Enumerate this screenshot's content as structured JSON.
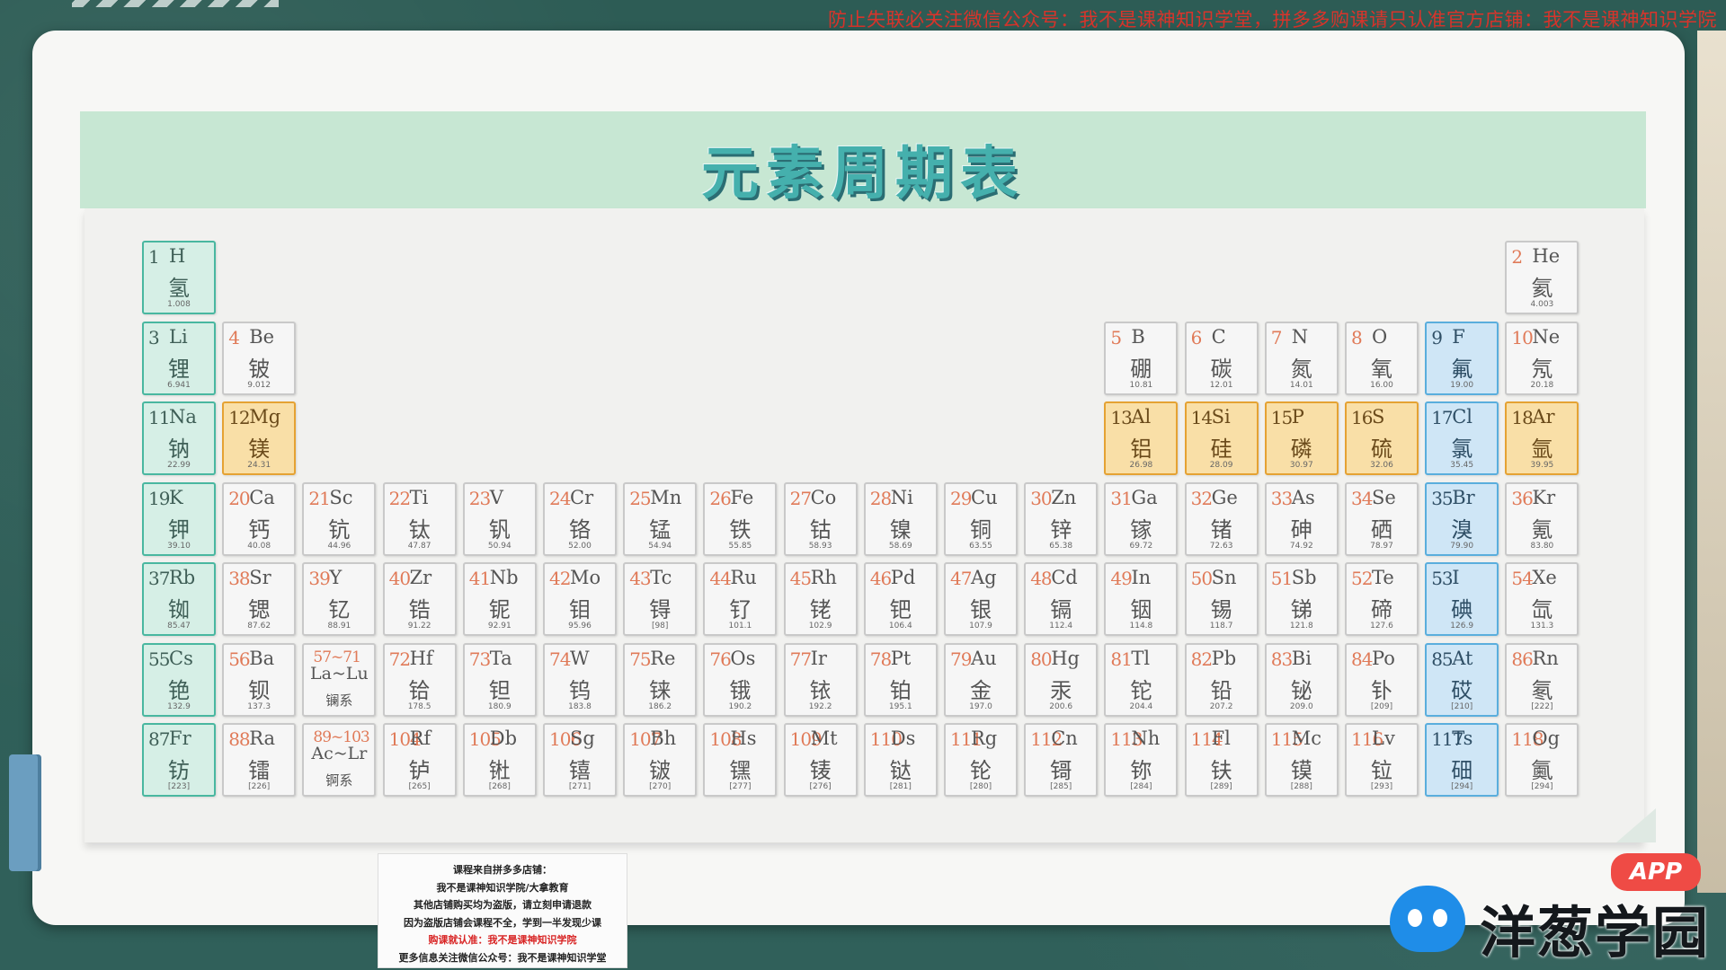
{
  "top_notice": "防止失联必关注微信公众号：我不是课神知识学堂，拼多多购课请只认准官方店铺：我不是课神知识学院",
  "title": "元素周期表",
  "colors": {
    "alkali": "#d6efe6",
    "metal": "#f9dfa7",
    "halogen": "#cfe6f6",
    "default": "#f6f6f6",
    "number": "#e07a58"
  },
  "elements": [
    {
      "n": "1",
      "s": "H",
      "c": "氢",
      "m": "1.008",
      "row": 1,
      "col": 1,
      "t": "alkali"
    },
    {
      "n": "2",
      "s": "He",
      "c": "氦",
      "m": "4.003",
      "row": 1,
      "col": 18,
      "t": ""
    },
    {
      "n": "3",
      "s": "Li",
      "c": "锂",
      "m": "6.941",
      "row": 2,
      "col": 1,
      "t": "alkali"
    },
    {
      "n": "4",
      "s": "Be",
      "c": "铍",
      "m": "9.012",
      "row": 2,
      "col": 2,
      "t": ""
    },
    {
      "n": "5",
      "s": "B",
      "c": "硼",
      "m": "10.81",
      "row": 2,
      "col": 13,
      "t": ""
    },
    {
      "n": "6",
      "s": "C",
      "c": "碳",
      "m": "12.01",
      "row": 2,
      "col": 14,
      "t": ""
    },
    {
      "n": "7",
      "s": "N",
      "c": "氮",
      "m": "14.01",
      "row": 2,
      "col": 15,
      "t": ""
    },
    {
      "n": "8",
      "s": "O",
      "c": "氧",
      "m": "16.00",
      "row": 2,
      "col": 16,
      "t": ""
    },
    {
      "n": "9",
      "s": "F",
      "c": "氟",
      "m": "19.00",
      "row": 2,
      "col": 17,
      "t": "halogen"
    },
    {
      "n": "10",
      "s": "Ne",
      "c": "氖",
      "m": "20.18",
      "row": 2,
      "col": 18,
      "t": ""
    },
    {
      "n": "11",
      "s": "Na",
      "c": "钠",
      "m": "22.99",
      "row": 3,
      "col": 1,
      "t": "alkali"
    },
    {
      "n": "12",
      "s": "Mg",
      "c": "镁",
      "m": "24.31",
      "row": 3,
      "col": 2,
      "t": "metal"
    },
    {
      "n": "13",
      "s": "Al",
      "c": "铝",
      "m": "26.98",
      "row": 3,
      "col": 13,
      "t": "metal"
    },
    {
      "n": "14",
      "s": "Si",
      "c": "硅",
      "m": "28.09",
      "row": 3,
      "col": 14,
      "t": "metal"
    },
    {
      "n": "15",
      "s": "P",
      "c": "磷",
      "m": "30.97",
      "row": 3,
      "col": 15,
      "t": "metal"
    },
    {
      "n": "16",
      "s": "S",
      "c": "硫",
      "m": "32.06",
      "row": 3,
      "col": 16,
      "t": "metal"
    },
    {
      "n": "17",
      "s": "Cl",
      "c": "氯",
      "m": "35.45",
      "row": 3,
      "col": 17,
      "t": "halogen"
    },
    {
      "n": "18",
      "s": "Ar",
      "c": "氩",
      "m": "39.95",
      "row": 3,
      "col": 18,
      "t": "metal"
    },
    {
      "n": "19",
      "s": "K",
      "c": "钾",
      "m": "39.10",
      "row": 4,
      "col": 1,
      "t": "alkali"
    },
    {
      "n": "20",
      "s": "Ca",
      "c": "钙",
      "m": "40.08",
      "row": 4,
      "col": 2,
      "t": ""
    },
    {
      "n": "21",
      "s": "Sc",
      "c": "钪",
      "m": "44.96",
      "row": 4,
      "col": 3,
      "t": ""
    },
    {
      "n": "22",
      "s": "Ti",
      "c": "钛",
      "m": "47.87",
      "row": 4,
      "col": 4,
      "t": ""
    },
    {
      "n": "23",
      "s": "V",
      "c": "钒",
      "m": "50.94",
      "row": 4,
      "col": 5,
      "t": ""
    },
    {
      "n": "24",
      "s": "Cr",
      "c": "铬",
      "m": "52.00",
      "row": 4,
      "col": 6,
      "t": ""
    },
    {
      "n": "25",
      "s": "Mn",
      "c": "锰",
      "m": "54.94",
      "row": 4,
      "col": 7,
      "t": ""
    },
    {
      "n": "26",
      "s": "Fe",
      "c": "铁",
      "m": "55.85",
      "row": 4,
      "col": 8,
      "t": ""
    },
    {
      "n": "27",
      "s": "Co",
      "c": "钴",
      "m": "58.93",
      "row": 4,
      "col": 9,
      "t": ""
    },
    {
      "n": "28",
      "s": "Ni",
      "c": "镍",
      "m": "58.69",
      "row": 4,
      "col": 10,
      "t": ""
    },
    {
      "n": "29",
      "s": "Cu",
      "c": "铜",
      "m": "63.55",
      "row": 4,
      "col": 11,
      "t": ""
    },
    {
      "n": "30",
      "s": "Zn",
      "c": "锌",
      "m": "65.38",
      "row": 4,
      "col": 12,
      "t": ""
    },
    {
      "n": "31",
      "s": "Ga",
      "c": "镓",
      "m": "69.72",
      "row": 4,
      "col": 13,
      "t": ""
    },
    {
      "n": "32",
      "s": "Ge",
      "c": "锗",
      "m": "72.63",
      "row": 4,
      "col": 14,
      "t": ""
    },
    {
      "n": "33",
      "s": "As",
      "c": "砷",
      "m": "74.92",
      "row": 4,
      "col": 15,
      "t": ""
    },
    {
      "n": "34",
      "s": "Se",
      "c": "硒",
      "m": "78.97",
      "row": 4,
      "col": 16,
      "t": ""
    },
    {
      "n": "35",
      "s": "Br",
      "c": "溴",
      "m": "79.90",
      "row": 4,
      "col": 17,
      "t": "halogen"
    },
    {
      "n": "36",
      "s": "Kr",
      "c": "氪",
      "m": "83.80",
      "row": 4,
      "col": 18,
      "t": ""
    },
    {
      "n": "37",
      "s": "Rb",
      "c": "铷",
      "m": "85.47",
      "row": 5,
      "col": 1,
      "t": "alkali"
    },
    {
      "n": "38",
      "s": "Sr",
      "c": "锶",
      "m": "87.62",
      "row": 5,
      "col": 2,
      "t": ""
    },
    {
      "n": "39",
      "s": "Y",
      "c": "钇",
      "m": "88.91",
      "row": 5,
      "col": 3,
      "t": ""
    },
    {
      "n": "40",
      "s": "Zr",
      "c": "锆",
      "m": "91.22",
      "row": 5,
      "col": 4,
      "t": ""
    },
    {
      "n": "41",
      "s": "Nb",
      "c": "铌",
      "m": "92.91",
      "row": 5,
      "col": 5,
      "t": ""
    },
    {
      "n": "42",
      "s": "Mo",
      "c": "钼",
      "m": "95.96",
      "row": 5,
      "col": 6,
      "t": ""
    },
    {
      "n": "43",
      "s": "Tc",
      "c": "锝",
      "m": "[98]",
      "row": 5,
      "col": 7,
      "t": ""
    },
    {
      "n": "44",
      "s": "Ru",
      "c": "钌",
      "m": "101.1",
      "row": 5,
      "col": 8,
      "t": ""
    },
    {
      "n": "45",
      "s": "Rh",
      "c": "铑",
      "m": "102.9",
      "row": 5,
      "col": 9,
      "t": ""
    },
    {
      "n": "46",
      "s": "Pd",
      "c": "钯",
      "m": "106.4",
      "row": 5,
      "col": 10,
      "t": ""
    },
    {
      "n": "47",
      "s": "Ag",
      "c": "银",
      "m": "107.9",
      "row": 5,
      "col": 11,
      "t": ""
    },
    {
      "n": "48",
      "s": "Cd",
      "c": "镉",
      "m": "112.4",
      "row": 5,
      "col": 12,
      "t": ""
    },
    {
      "n": "49",
      "s": "In",
      "c": "铟",
      "m": "114.8",
      "row": 5,
      "col": 13,
      "t": ""
    },
    {
      "n": "50",
      "s": "Sn",
      "c": "锡",
      "m": "118.7",
      "row": 5,
      "col": 14,
      "t": ""
    },
    {
      "n": "51",
      "s": "Sb",
      "c": "锑",
      "m": "121.8",
      "row": 5,
      "col": 15,
      "t": ""
    },
    {
      "n": "52",
      "s": "Te",
      "c": "碲",
      "m": "127.6",
      "row": 5,
      "col": 16,
      "t": ""
    },
    {
      "n": "53",
      "s": "I",
      "c": "碘",
      "m": "126.9",
      "row": 5,
      "col": 17,
      "t": "halogen"
    },
    {
      "n": "54",
      "s": "Xe",
      "c": "氙",
      "m": "131.3",
      "row": 5,
      "col": 18,
      "t": ""
    },
    {
      "n": "55",
      "s": "Cs",
      "c": "铯",
      "m": "132.9",
      "row": 6,
      "col": 1,
      "t": "alkali"
    },
    {
      "n": "56",
      "s": "Ba",
      "c": "钡",
      "m": "137.3",
      "row": 6,
      "col": 2,
      "t": ""
    },
    {
      "n": "57~71",
      "s": "La~Lu",
      "c": "镧系",
      "m": "",
      "row": 6,
      "col": 3,
      "t": "lanth"
    },
    {
      "n": "72",
      "s": "Hf",
      "c": "铪",
      "m": "178.5",
      "row": 6,
      "col": 4,
      "t": ""
    },
    {
      "n": "73",
      "s": "Ta",
      "c": "钽",
      "m": "180.9",
      "row": 6,
      "col": 5,
      "t": ""
    },
    {
      "n": "74",
      "s": "W",
      "c": "钨",
      "m": "183.8",
      "row": 6,
      "col": 6,
      "t": ""
    },
    {
      "n": "75",
      "s": "Re",
      "c": "铼",
      "m": "186.2",
      "row": 6,
      "col": 7,
      "t": ""
    },
    {
      "n": "76",
      "s": "Os",
      "c": "锇",
      "m": "190.2",
      "row": 6,
      "col": 8,
      "t": ""
    },
    {
      "n": "77",
      "s": "Ir",
      "c": "铱",
      "m": "192.2",
      "row": 6,
      "col": 9,
      "t": ""
    },
    {
      "n": "78",
      "s": "Pt",
      "c": "铂",
      "m": "195.1",
      "row": 6,
      "col": 10,
      "t": ""
    },
    {
      "n": "79",
      "s": "Au",
      "c": "金",
      "m": "197.0",
      "row": 6,
      "col": 11,
      "t": ""
    },
    {
      "n": "80",
      "s": "Hg",
      "c": "汞",
      "m": "200.6",
      "row": 6,
      "col": 12,
      "t": ""
    },
    {
      "n": "81",
      "s": "Tl",
      "c": "铊",
      "m": "204.4",
      "row": 6,
      "col": 13,
      "t": ""
    },
    {
      "n": "82",
      "s": "Pb",
      "c": "铅",
      "m": "207.2",
      "row": 6,
      "col": 14,
      "t": ""
    },
    {
      "n": "83",
      "s": "Bi",
      "c": "铋",
      "m": "209.0",
      "row": 6,
      "col": 15,
      "t": ""
    },
    {
      "n": "84",
      "s": "Po",
      "c": "钋",
      "m": "[209]",
      "row": 6,
      "col": 16,
      "t": ""
    },
    {
      "n": "85",
      "s": "At",
      "c": "砹",
      "m": "[210]",
      "row": 6,
      "col": 17,
      "t": "halogen"
    },
    {
      "n": "86",
      "s": "Rn",
      "c": "氡",
      "m": "[222]",
      "row": 6,
      "col": 18,
      "t": ""
    },
    {
      "n": "87",
      "s": "Fr",
      "c": "钫",
      "m": "[223]",
      "row": 7,
      "col": 1,
      "t": "alkali"
    },
    {
      "n": "88",
      "s": "Ra",
      "c": "镭",
      "m": "[226]",
      "row": 7,
      "col": 2,
      "t": ""
    },
    {
      "n": "89~103",
      "s": "Ac~Lr",
      "c": "锕系",
      "m": "",
      "row": 7,
      "col": 3,
      "t": "lanth"
    },
    {
      "n": "104",
      "s": "Rf",
      "c": "𬬻",
      "m": "[265]",
      "row": 7,
      "col": 4,
      "t": ""
    },
    {
      "n": "105",
      "s": "Db",
      "c": "𬭊",
      "m": "[268]",
      "row": 7,
      "col": 5,
      "t": ""
    },
    {
      "n": "106",
      "s": "Sg",
      "c": "𬭳",
      "m": "[271]",
      "row": 7,
      "col": 6,
      "t": ""
    },
    {
      "n": "107",
      "s": "Bh",
      "c": "𬭛",
      "m": "[270]",
      "row": 7,
      "col": 7,
      "t": ""
    },
    {
      "n": "108",
      "s": "Hs",
      "c": "𬭶",
      "m": "[277]",
      "row": 7,
      "col": 8,
      "t": ""
    },
    {
      "n": "109",
      "s": "Mt",
      "c": "鿏",
      "m": "[276]",
      "row": 7,
      "col": 9,
      "t": ""
    },
    {
      "n": "110",
      "s": "Ds",
      "c": "𫟼",
      "m": "[281]",
      "row": 7,
      "col": 10,
      "t": ""
    },
    {
      "n": "111",
      "s": "Rg",
      "c": "𬬭",
      "m": "[280]",
      "row": 7,
      "col": 11,
      "t": ""
    },
    {
      "n": "112",
      "s": "Cn",
      "c": "鿔",
      "m": "[285]",
      "row": 7,
      "col": 12,
      "t": ""
    },
    {
      "n": "113",
      "s": "Nh",
      "c": "鿭",
      "m": "[284]",
      "row": 7,
      "col": 13,
      "t": ""
    },
    {
      "n": "114",
      "s": "Fl",
      "c": "𫓧",
      "m": "[289]",
      "row": 7,
      "col": 14,
      "t": ""
    },
    {
      "n": "115",
      "s": "Mc",
      "c": "镆",
      "m": "[288]",
      "row": 7,
      "col": 15,
      "t": ""
    },
    {
      "n": "116",
      "s": "Lv",
      "c": "𫟷",
      "m": "[293]",
      "row": 7,
      "col": 16,
      "t": ""
    },
    {
      "n": "117",
      "s": "Ts",
      "c": "鿬",
      "m": "[294]",
      "row": 7,
      "col": 17,
      "t": "halogen"
    },
    {
      "n": "118",
      "s": "Og",
      "c": "鿫",
      "m": "[294]",
      "row": 7,
      "col": 18,
      "t": ""
    }
  ],
  "notice_box": {
    "line1": "课程来自拼多多店铺：",
    "line2": "我不是课神知识学院/大拿教育",
    "line3": "其他店铺购买均为盗版，请立刻申请退款",
    "line4": "因为盗版店铺会课程不全，学到一半发现少课",
    "line5": "购课就认准：我不是课神知识学院",
    "line6": "更多信息关注微信公众号：我不是课神知识学堂"
  },
  "brand": {
    "app_badge": "APP",
    "name": "洋葱学园",
    "logo_icon": "onion-mascot-icon"
  }
}
